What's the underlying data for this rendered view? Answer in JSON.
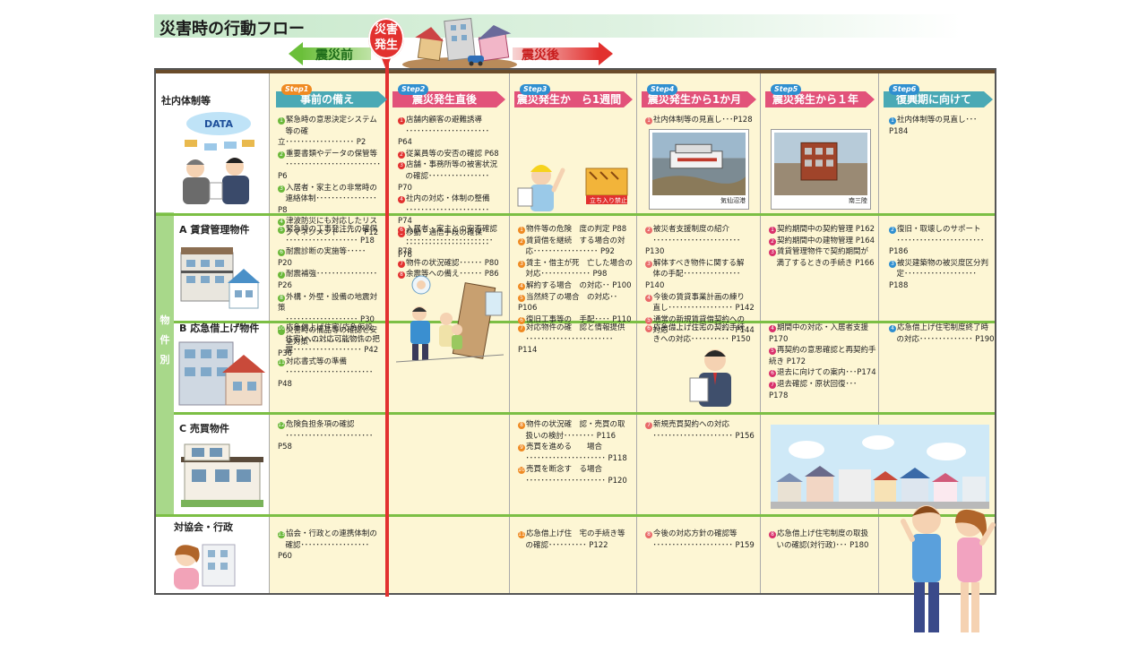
{
  "title": "災害時の行動フロー",
  "arrows": {
    "before": "震災前",
    "after": "震災後",
    "pin": [
      "災害",
      "発生"
    ]
  },
  "colors": {
    "red": "#e2312f",
    "green": "#7cbf45",
    "cream": "#fdf6d4"
  },
  "steps": [
    {
      "badge": "Step1",
      "label": "事前の備え"
    },
    {
      "badge": "Step2",
      "label": "震災発生直後"
    },
    {
      "badge": "Step3",
      "label": "震災発生か　ら1週間"
    },
    {
      "badge": "Step4",
      "label": "震災発生から1か月"
    },
    {
      "badge": "Step5",
      "label": "震災発生から１年"
    },
    {
      "badge": "Step6",
      "label": "復興期に向けて"
    }
  ],
  "side_label": [
    "物",
    "件",
    "別"
  ],
  "rows": [
    {
      "title": "社内体制等"
    },
    {
      "title": "A 賃貸管理物件"
    },
    {
      "title": "B 応急借上げ物件"
    },
    {
      "title": "C 売買物件"
    },
    {
      "title": "対協会・行政"
    }
  ],
  "illustration_text": {
    "data": "DATA",
    "sign": "立ち入り禁止"
  },
  "photos": {
    "p1": "気仙沼港",
    "p2": "南三陸"
  },
  "cells": {
    "r0c1": [
      [
        "1",
        "緊急時の意思決定システム"
      ],
      [
        "",
        "　等の確立･･････････････････ P2"
      ],
      [
        "2",
        "重要書類やデータの保管等"
      ],
      [
        "",
        "　･････････････････････････ P6"
      ],
      [
        "3",
        "入居者・家主との非常時の"
      ],
      [
        "",
        "　連絡体制････････････････ P8"
      ],
      [
        "4",
        "津波防災にも対応したリス"
      ],
      [
        "",
        "　クマネジメント･･････ P12"
      ]
    ],
    "r0c2": [
      [
        "1",
        "店舗内顧客の避難誘導"
      ],
      [
        "",
        "　･･････････････････････ P64"
      ],
      [
        "2",
        "従業員等の安否の確認 P68"
      ],
      [
        "3",
        "店舗・事務所等の被害状況"
      ],
      [
        "",
        "　の確認････････････････ P70"
      ],
      [
        "4",
        "社内の対応・体制の整備"
      ],
      [
        "",
        "　･･････････････････････ P74"
      ],
      [
        "5",
        "移動・通信手段の確保"
      ],
      [
        "",
        "　･･････････････････････ P76"
      ]
    ],
    "r0c4": [
      [
        "1",
        "社内体制等の見直し･･･P128"
      ]
    ],
    "r0c6": [
      [
        "1",
        "社内体制等の見直し･･･P184"
      ]
    ],
    "r1c1": [
      [
        "5",
        "緊急時の工事発注先の確保"
      ],
      [
        "",
        "　･･･････････････････ P18"
      ],
      [
        "6",
        "耐震診断の実施等･････ P20"
      ],
      [
        "7",
        "耐震補強････････････････ P26"
      ],
      [
        "8",
        "外構・外壁・設備の地震対策"
      ],
      [
        "",
        "　･･･････････････････ P30"
      ],
      [
        "9",
        "災害時の備品等の確認と安"
      ],
      [
        "",
        "　全対策････････････････ P36"
      ]
    ],
    "r1c2": [
      [
        "6",
        "入居者・家主との安否確認"
      ],
      [
        "",
        "　･･･････････････････････ P78"
      ],
      [
        "7",
        "物件の状況確認･･････ P80"
      ],
      [
        "8",
        "余震等への備え･･････ P86"
      ]
    ],
    "r1c3": [
      [
        "1",
        "物件等の危険　度の判定 P88"
      ],
      [
        "2",
        "賃貸借を継続　する場合の対"
      ],
      [
        "",
        "　応･････････････････ P92"
      ],
      [
        "3",
        "賃主・借主が死　亡した場合の"
      ],
      [
        "",
        "　対応･････････････ P98"
      ],
      [
        "4",
        "解約する場合　の対応･･ P100"
      ],
      [
        "5",
        "当然終了の場合　の対応･･ P106"
      ],
      [
        "6",
        "復旧工事等の　手配････ P110"
      ]
    ],
    "r1c4": [
      [
        "2",
        "被災者支援制度の紹介"
      ],
      [
        "",
        "　･･･････････････････････ P130"
      ],
      [
        "3",
        "解体すべき物件に関する解"
      ],
      [
        "",
        "　体の手配･･･････････････ P140"
      ],
      [
        "4",
        "今後の賃貸事業計画の練り"
      ],
      [
        "",
        "　直し･････････････････ P142"
      ],
      [
        "5",
        "通常の新規賃貸借契約への"
      ],
      [
        "",
        "　対応･････････････････ P144"
      ]
    ],
    "r1c5": [
      [
        "1",
        "契約期間中の契約管理 P162"
      ],
      [
        "2",
        "契約期間中の建物管理 P164"
      ],
      [
        "3",
        "賃貸管理物件で契約期間が"
      ],
      [
        "",
        "　満了するときの手続き P166"
      ]
    ],
    "r1c6": [
      [
        "2",
        "復旧・取壊しのサポート"
      ],
      [
        "",
        "　･･･････････････････････ P186"
      ],
      [
        "3",
        "被災建築物の被災度区分判"
      ],
      [
        "",
        "　定･･･････････････････ P188"
      ]
    ],
    "r2c1": [
      [
        "10",
        "応急借上げ住宅(応急仮設"
      ],
      [
        "",
        "　住宅)への対応可能物件の把"
      ],
      [
        "",
        "　握･･････････････････ P42"
      ],
      [
        "11",
        "対応書式等の準備"
      ],
      [
        "",
        "　･･･････････････････････ P48"
      ]
    ],
    "r2c3": [
      [
        "7",
        "対応物件の確　認と情報提供"
      ],
      [
        "",
        "　･･･････････････････････ P114"
      ]
    ],
    "r2c4": [
      [
        "6",
        "応急借上げ住宅の契約手続"
      ],
      [
        "",
        "　きへの対応･･････････ P150"
      ]
    ],
    "r2c5": [
      [
        "4",
        "期間中の対応・入居者支援 P170"
      ],
      [
        "5",
        "再契約の意思確認と再契約手続き P172"
      ],
      [
        "6",
        "退去に向けての案内･･･P174"
      ],
      [
        "7",
        "退去確認・原状回復･･･ P178"
      ]
    ],
    "r2c6": [
      [
        "4",
        "応急借上げ住宅制度終了時"
      ],
      [
        "",
        "　の対応･･････････････ P190"
      ]
    ],
    "r3c1": [
      [
        "12",
        "危険負担条項の確認"
      ],
      [
        "",
        "　･･･････････････････････ P58"
      ]
    ],
    "r3c3": [
      [
        "8",
        "物件の状況確　認・売買の取"
      ],
      [
        "",
        "　扱いの検討････････ P116"
      ],
      [
        "9",
        "売買を進める　　場合"
      ],
      [
        "",
        "　･････････････････････ P118"
      ],
      [
        "10",
        "売買を断念す　る場合"
      ],
      [
        "",
        "　･････････････････････ P120"
      ]
    ],
    "r3c4": [
      [
        "7",
        "新規売買契約への対応"
      ],
      [
        "",
        "　･････････････････････ P156"
      ]
    ],
    "r4c1": [
      [
        "13",
        "協会・行政との連携体制の"
      ],
      [
        "",
        "　確認･･････････････････ P60"
      ]
    ],
    "r4c3": [
      [
        "11",
        "応急借上げ住　宅の手続き等"
      ],
      [
        "",
        "　の確認･･････････ P122"
      ]
    ],
    "r4c4": [
      [
        "8",
        "今後の対応方針の確認等"
      ],
      [
        "",
        "　･････････････････････ P159"
      ]
    ],
    "r4c5": [
      [
        "8",
        "応急借上げ住宅制度の取扱"
      ],
      [
        "",
        "　いの確認(対行政)･･･ P180"
      ]
    ]
  }
}
